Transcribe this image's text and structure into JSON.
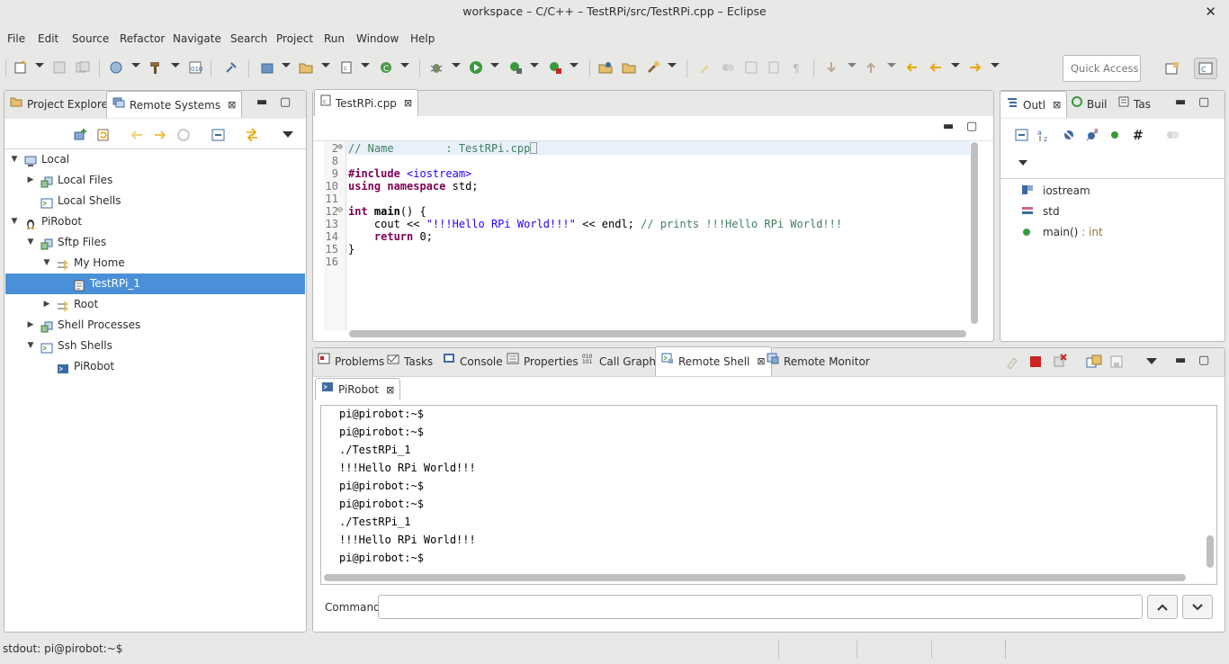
{
  "window": {
    "title": "workspace – C/C++ – TestRPi/src/TestRPi.cpp – Eclipse",
    "close_glyph": "✕"
  },
  "menu": [
    "File",
    "Edit",
    "Source",
    "Refactor",
    "Navigate",
    "Search",
    "Project",
    "Run",
    "Window",
    "Help"
  ],
  "toolbar": {
    "quick_access_placeholder": "Quick Access"
  },
  "left_panel": {
    "tabs": [
      {
        "label": "Project Explorer",
        "icon": "folder-icon"
      },
      {
        "label": "Remote Systems",
        "icon": "remote-systems-icon",
        "active": true
      }
    ],
    "tree": [
      {
        "label": "Local",
        "level": 0,
        "expanded": true,
        "icon": "computer-icon"
      },
      {
        "label": "Local Files",
        "level": 1,
        "expanded": false,
        "icon": "files-icon"
      },
      {
        "label": "Local Shells",
        "level": 1,
        "leaf": true,
        "icon": "shells-icon"
      },
      {
        "label": "PiRobot",
        "level": 0,
        "expanded": true,
        "icon": "linux-host-icon"
      },
      {
        "label": "Sftp Files",
        "level": 1,
        "expanded": true,
        "icon": "files-icon"
      },
      {
        "label": "My Home",
        "level": 2,
        "expanded": true,
        "icon": "filter-icon"
      },
      {
        "label": "TestRPi_1",
        "level": 3,
        "leaf": true,
        "selected": true,
        "icon": "file-icon"
      },
      {
        "label": "Root",
        "level": 2,
        "expanded": false,
        "icon": "filter-icon"
      },
      {
        "label": "Shell Processes",
        "level": 1,
        "expanded": false,
        "icon": "processes-icon"
      },
      {
        "label": "Ssh Shells",
        "level": 1,
        "expanded": true,
        "icon": "shells-icon"
      },
      {
        "label": "PiRobot",
        "level": 2,
        "leaf": true,
        "icon": "shell-icon"
      }
    ]
  },
  "editor": {
    "tab_label": "TestRPi.cpp",
    "lines": [
      {
        "num": "2",
        "folded": true,
        "text": "// Name        : TestRPi.cpp"
      },
      {
        "num": "8",
        "text": ""
      },
      {
        "num": "9",
        "text": "#include <iostream>"
      },
      {
        "num": "10",
        "text": "using namespace std;"
      },
      {
        "num": "11",
        "text": ""
      },
      {
        "num": "12",
        "fold": true,
        "text": "int main() {"
      },
      {
        "num": "13",
        "text": "    cout << \"!!!Hello RPi World!!!\" << endl; // prints !!!Hello RPi World!!!"
      },
      {
        "num": "14",
        "text": "    return 0;"
      },
      {
        "num": "15",
        "text": "}"
      },
      {
        "num": "16",
        "text": ""
      }
    ]
  },
  "outline_panel": {
    "tabs": [
      {
        "label": "Outl",
        "icon": "outline-icon",
        "active": true
      },
      {
        "label": "Buil",
        "icon": "build-icon"
      },
      {
        "label": "Tas",
        "icon": "tasks-icon"
      }
    ],
    "items": [
      {
        "label": "iostream",
        "icon": "include-icon"
      },
      {
        "label": "std",
        "icon": "namespace-icon"
      },
      {
        "label": "main()",
        "type": " : int",
        "icon": "function-icon"
      }
    ]
  },
  "bottom_panel": {
    "tabs": [
      {
        "label": "Problems",
        "icon": "problems-icon"
      },
      {
        "label": "Tasks",
        "icon": "tasks-icon"
      },
      {
        "label": "Console",
        "icon": "console-icon"
      },
      {
        "label": "Properties",
        "icon": "properties-icon"
      },
      {
        "label": "Call Graph",
        "icon": "call-graph-icon"
      },
      {
        "label": "Remote Shell",
        "icon": "remote-shell-icon",
        "active": true
      },
      {
        "label": "Remote Monitor",
        "icon": "remote-monitor-icon"
      }
    ],
    "shell_tab": "PiRobot",
    "output": [
      "pi@pirobot:~$",
      "pi@pirobot:~$",
      "./TestRPi_1",
      "!!!Hello RPi World!!!",
      "pi@pirobot:~$",
      "pi@pirobot:~$",
      "./TestRPi_1",
      "!!!Hello RPi World!!!",
      "pi@pirobot:~$"
    ],
    "command_label": "Command",
    "command_value": ""
  },
  "status": {
    "text": "stdout: pi@pirobot:~$"
  },
  "colors": {
    "selection": "#4a90d9",
    "keyword": "#7f0055",
    "string": "#2a00ff",
    "comment": "#3f7f5f"
  }
}
